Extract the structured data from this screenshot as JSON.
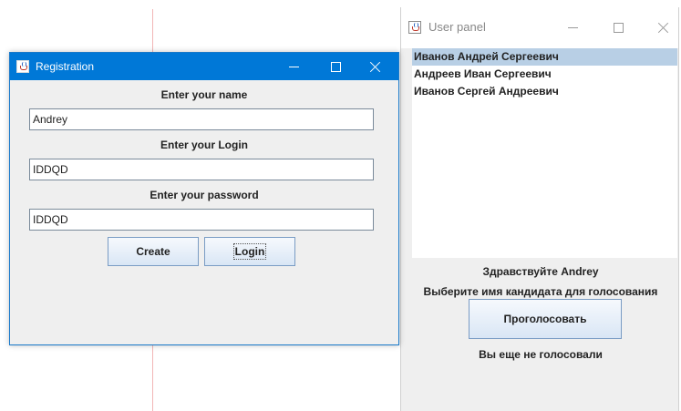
{
  "user_panel": {
    "title": "User panel",
    "candidates": [
      {
        "name": "Иванов Андрей Сергеевич",
        "selected": true
      },
      {
        "name": "Андреев Иван Сергеевич",
        "selected": false
      },
      {
        "name": "Иванов Сергей Андреевич",
        "selected": false
      }
    ],
    "greeting": "Здравствуйте Andrey",
    "instruction": "Выберите имя кандидата для голосования",
    "vote_label": "Проголосовать",
    "vote_status": "Вы еще не голосовали"
  },
  "registration": {
    "title": "Registration",
    "name_label": "Enter your name",
    "name_value": "Andrey",
    "login_label": "Enter your Login",
    "login_value": "IDDQD",
    "password_label": "Enter your password",
    "password_value": "IDDQD",
    "create_label": "Create",
    "login_button_label": "Login"
  },
  "colors": {
    "active_titlebar": "#0078d7",
    "selection": "#b8cfe5",
    "window_background": "#efefef"
  },
  "icons": {
    "window_icon": "java-coffee-cup-icon",
    "minimize": "minimize-icon",
    "maximize": "maximize-icon",
    "close": "close-icon"
  }
}
